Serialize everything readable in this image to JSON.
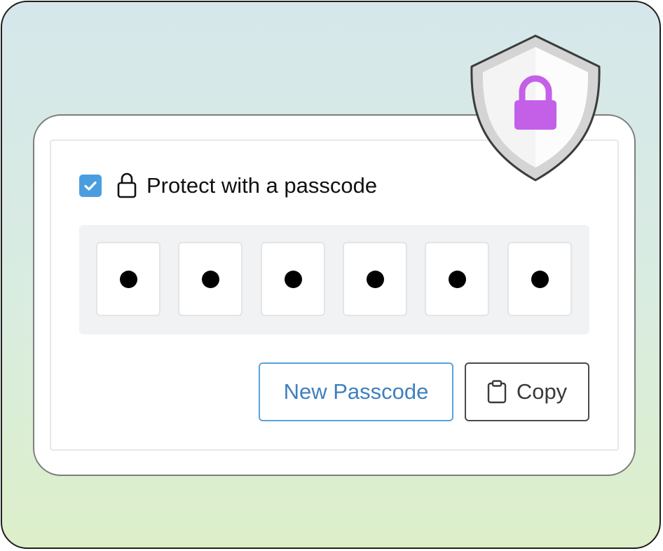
{
  "protection": {
    "checkbox_checked": true,
    "label": "Protect with a passcode"
  },
  "passcode": {
    "digits": [
      "•",
      "•",
      "•",
      "•",
      "•",
      "•"
    ],
    "length": 6
  },
  "actions": {
    "new_passcode_label": "New Passcode",
    "copy_label": "Copy"
  },
  "icons": {
    "checkbox": "checkmark-icon",
    "label_icon": "lock-icon",
    "copy_icon": "clipboard-icon",
    "badge": "shield-lock-icon"
  },
  "colors": {
    "checkbox_fill": "#4a9ee0",
    "accent_blue": "#3f80bd",
    "lock_purple": "#c45fe8"
  }
}
